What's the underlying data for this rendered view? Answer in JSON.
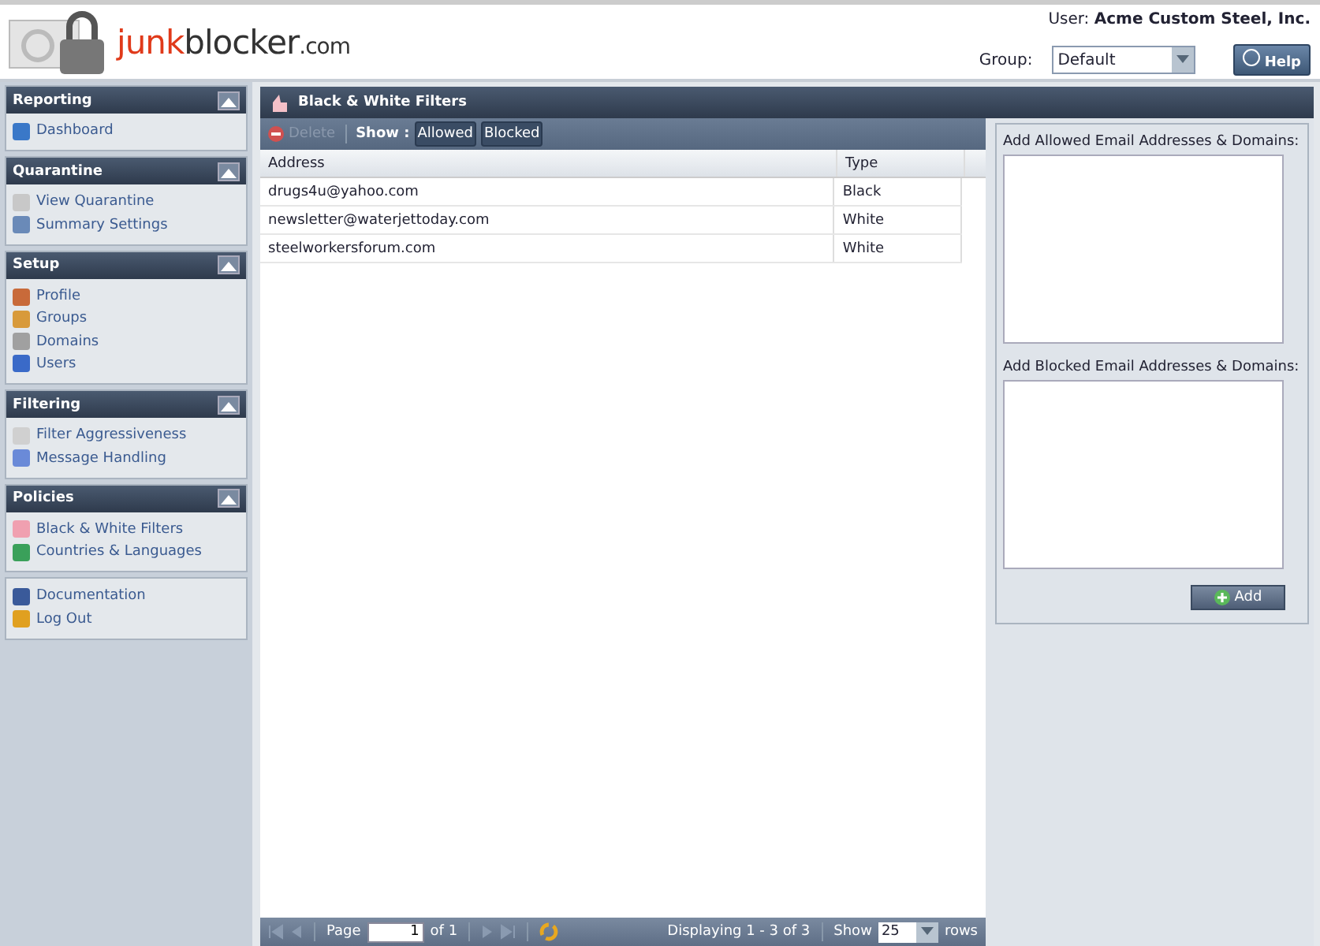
{
  "header": {
    "logo": [
      {
        "text": "junk",
        "kind": "accent"
      },
      {
        "text": "blocker",
        "kind": "plain"
      },
      {
        "text": ".com",
        "kind": "suffix"
      }
    ],
    "user_label": "User:",
    "user_name": "Acme Custom Steel, Inc.",
    "group_label": "Group:",
    "group_value": "Default",
    "help_button": "Help"
  },
  "sidebar": [
    {
      "title": "Reporting",
      "items": [
        {
          "label": "Dashboard"
        }
      ]
    },
    {
      "title": "Quarantine",
      "items": [
        {
          "label": "View Quarantine"
        },
        {
          "label": "Summary Settings"
        }
      ]
    },
    {
      "title": "Setup",
      "items": [
        {
          "label": "Profile"
        },
        {
          "label": "Groups"
        },
        {
          "label": "Domains"
        },
        {
          "label": "Users"
        }
      ]
    },
    {
      "title": "Filtering",
      "items": [
        {
          "label": "Filter Aggressiveness"
        },
        {
          "label": "Message Handling"
        }
      ]
    },
    {
      "title": "Policies",
      "items": [
        {
          "label": "Black & White Filters"
        },
        {
          "label": "Countries & Languages"
        }
      ]
    },
    {
      "items": [
        {
          "label": "Documentation"
        },
        {
          "label": "Log Out"
        }
      ]
    }
  ],
  "panel": {
    "title": "Black & White Filters",
    "toolbar": {
      "delete": {
        "label": "Delete",
        "disabled": true
      },
      "show_label": "Show :",
      "toggles": [
        {
          "label": "Allowed",
          "selected": true
        },
        {
          "label": "Blocked",
          "selected": true
        }
      ]
    },
    "table": {
      "columns": [
        "Address",
        "Type"
      ],
      "rows": [
        [
          "drugs4u@yahoo.com",
          "Black"
        ],
        [
          "newsletter@waterjettoday.com",
          "White"
        ],
        [
          "steelworkersforum.com",
          "White"
        ]
      ]
    },
    "pager": {
      "page_label": "Page",
      "page_value": "1",
      "of": "of 1",
      "displaying": "Displaying 1 - 3 of 3",
      "show_label": "Show",
      "rows_value": "25",
      "rows_label": "rows"
    },
    "side_form": {
      "allowed_label": "Add Allowed Email Addresses & Domains:",
      "blocked_label": "Add Blocked Email Addresses & Domains:",
      "add_button": "Add"
    }
  }
}
